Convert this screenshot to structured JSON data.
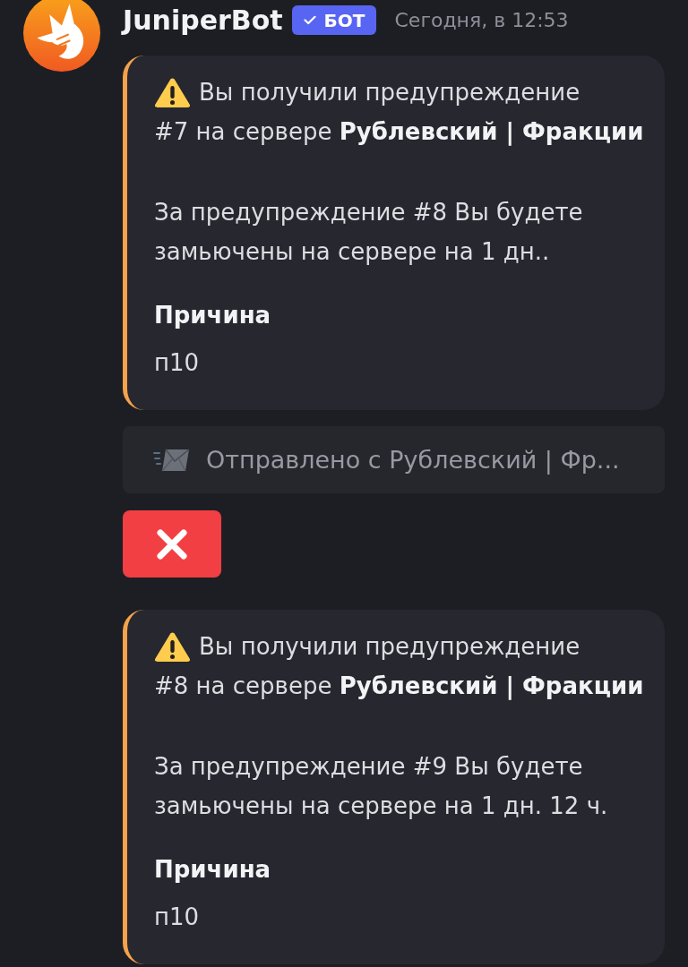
{
  "message": {
    "author": "JuniperBot",
    "badge": {
      "label": "БОТ",
      "verified": true
    },
    "timestamp": "Сегодня, в 12:53"
  },
  "items": [
    {
      "kind": "embed",
      "paragraphs": [
        {
          "kind": "warning",
          "lines": [
            "Вы получили предупреждение",
            "#7 на сервере **Рублевский | Фракции**"
          ]
        },
        {
          "kind": "plain",
          "text": "За предупреждение #8 Вы будете замьючены на сервере на 1 дн.."
        }
      ],
      "fields": [
        {
          "name": "Причина",
          "value": "п10"
        }
      ]
    },
    {
      "kind": "footer",
      "text": "Отправлено с Рублевский | Фр..."
    },
    {
      "kind": "close_button"
    },
    {
      "kind": "embed",
      "paragraphs": [
        {
          "kind": "warning",
          "lines": [
            "Вы получили предупреждение",
            "#8 на сервере **Рублевский | Фракции**"
          ]
        },
        {
          "kind": "plain",
          "text": "За предупреждение #9 Вы будете замьючены на сервере на 1 дн. 12 ч."
        }
      ],
      "fields": [
        {
          "name": "Причина",
          "value": "п10"
        }
      ]
    }
  ]
}
